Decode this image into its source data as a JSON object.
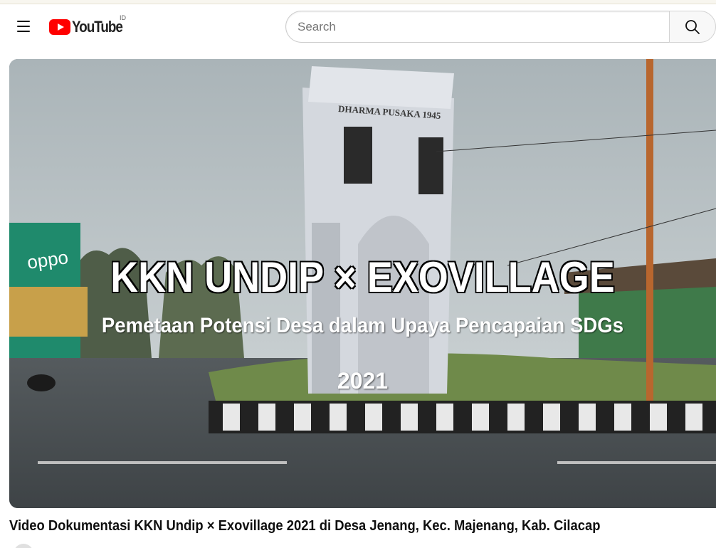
{
  "masthead": {
    "logo_text": "YouTube",
    "country_code": "ID",
    "search": {
      "placeholder": "Search",
      "value": ""
    }
  },
  "icons": {
    "menu": "hamburger-menu-icon",
    "search": "search-icon",
    "logo": "youtube-play-icon"
  },
  "player": {
    "overlay_title": "KKN UNDIP × EXOVILLAGE",
    "overlay_subtitle": "Pemetaan Potensi Desa dalam Upaya  Pencapaian SDGs",
    "overlay_year": "2021",
    "monument_text": "DHARMA PUSAKA 1945",
    "shop_sign": "oppo"
  },
  "video": {
    "title": "Video Dokumentasi KKN Undip × Exovillage 2021 di Desa Jenang, Kec. Majenang, Kab. Cilacap"
  },
  "colors": {
    "brand_red": "#ff0000",
    "text_primary": "#0f0f0f",
    "overlay_text": "#ffffff"
  }
}
